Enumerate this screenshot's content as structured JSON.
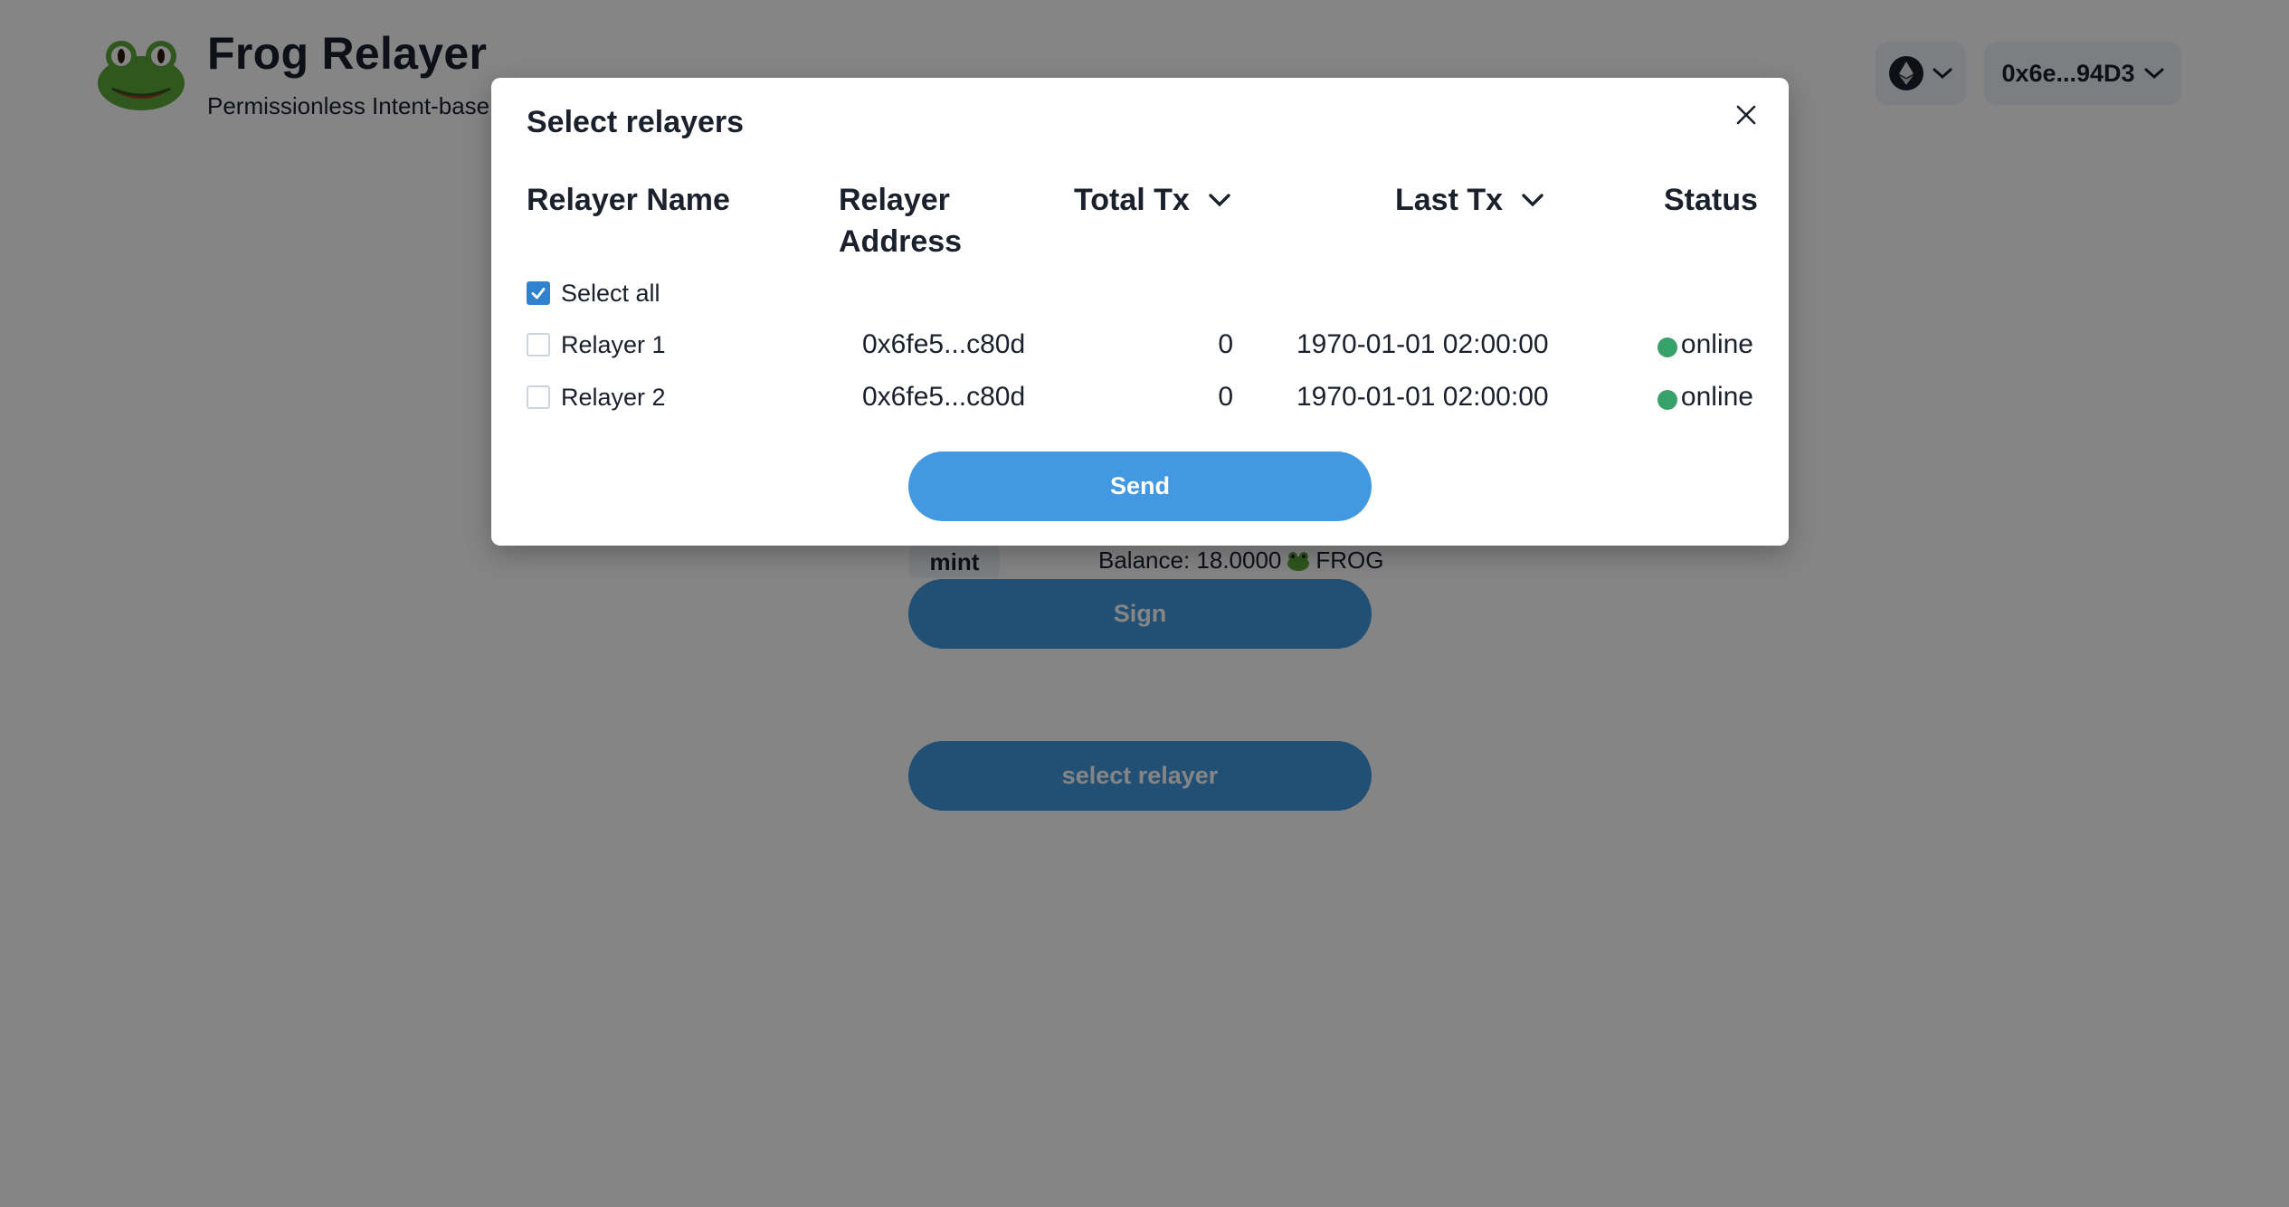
{
  "header": {
    "title": "Frog Relayer",
    "subtitle": "Permissionless Intent-base",
    "account": "0x6e...94D3"
  },
  "main": {
    "mint_label": "mint",
    "balance_label": "Balance: 18.0000",
    "balance_token": "FROG",
    "sign_label": "Sign",
    "select_relayer_label": "select relayer"
  },
  "modal": {
    "title": "Select relayers",
    "columns": {
      "name": "Relayer Name",
      "address": "Relayer Address",
      "total_tx": "Total Tx",
      "last_tx": "Last Tx",
      "status": "Status"
    },
    "select_all": {
      "label": "Select all",
      "checked": true
    },
    "rows": [
      {
        "name": "Relayer 1",
        "address": "0x6fe5...c80d",
        "total_tx": "0",
        "last_tx": "1970-01-01 02:00:00",
        "status": "online",
        "checked": false
      },
      {
        "name": "Relayer 2",
        "address": "0x6fe5...c80d",
        "total_tx": "0",
        "last_tx": "1970-01-01 02:00:00",
        "status": "online",
        "checked": false
      }
    ],
    "send_label": "Send"
  },
  "colors": {
    "accent": "#4299e1",
    "status_online": "#38a169",
    "checkbox_checked": "#3182ce"
  },
  "icons": [
    "frog-logo-icon",
    "ethereum-icon",
    "chevron-down-icon",
    "close-icon",
    "check-icon",
    "status-dot-icon"
  ]
}
